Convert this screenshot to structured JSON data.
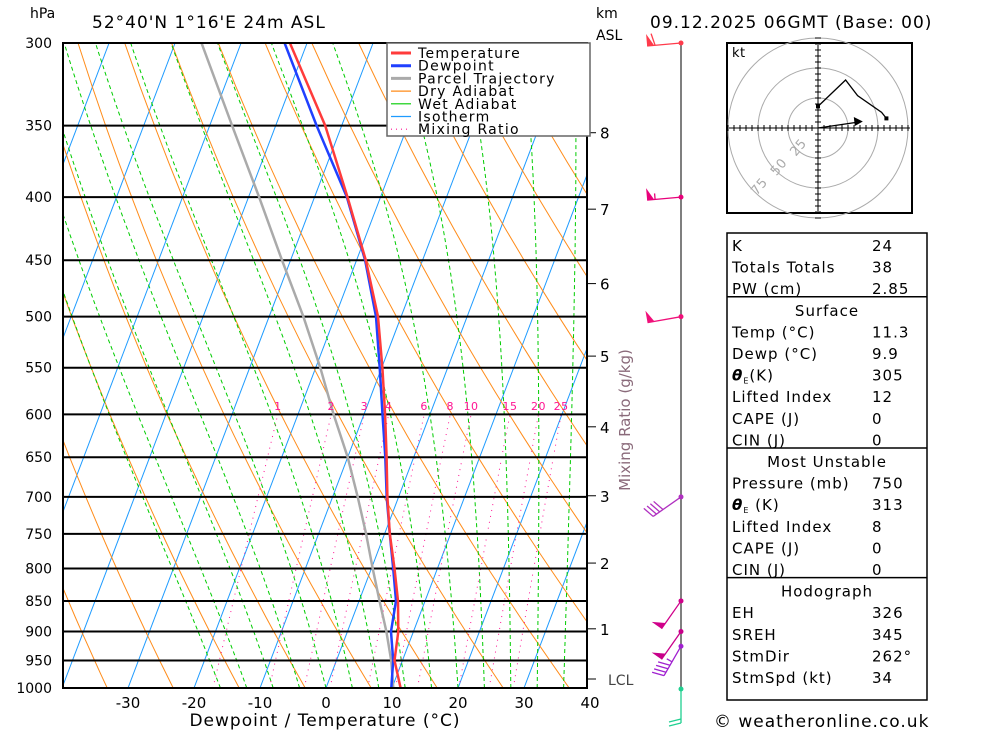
{
  "header": {
    "pressure_unit": "hPa",
    "location": "52°40'N 1°16'E 24m ASL",
    "height_unit": "km",
    "height_ref": "ASL",
    "datetime": "09.12.2025 06GMT (Base: 00)"
  },
  "chart_data": {
    "type": "skew-t",
    "xlabel": "Dewpoint / Temperature (°C)",
    "x_ticks": [
      -30,
      -20,
      -10,
      0,
      10,
      20,
      30,
      40
    ],
    "xlim": [
      -40,
      40
    ],
    "pressure_ticks": [
      300,
      350,
      400,
      450,
      500,
      550,
      600,
      650,
      700,
      750,
      800,
      850,
      900,
      950,
      1000
    ],
    "ylim_hpa": [
      1000,
      300
    ],
    "km_ticks": [
      1,
      2,
      3,
      4,
      5,
      6,
      7,
      8
    ],
    "lcl_label": "LCL",
    "mixing_ratio_label": "Mixing Ratio (g/kg)",
    "mixing_ratio_values": [
      1,
      2,
      3,
      4,
      6,
      8,
      10,
      15,
      20,
      25
    ],
    "legend": [
      {
        "label": "Temperature",
        "color": "#ff3b3b",
        "style": "thick"
      },
      {
        "label": "Dewpoint",
        "color": "#2040ff",
        "style": "thick"
      },
      {
        "label": "Parcel Trajectory",
        "color": "#aaaaaa",
        "style": "thick"
      },
      {
        "label": "Dry Adiabat",
        "color": "#ff8c1a",
        "style": "thin"
      },
      {
        "label": "Wet Adiabat",
        "color": "#00cc00",
        "style": "thin"
      },
      {
        "label": "Isotherm",
        "color": "#1e9bff",
        "style": "thin"
      },
      {
        "label": "Mixing Ratio",
        "color": "#ff1493",
        "style": "dotted"
      }
    ],
    "series": [
      {
        "name": "Temperature",
        "color": "#ff3b3b",
        "points": [
          [
            1000,
            11.3
          ],
          [
            950,
            8.8
          ],
          [
            900,
            7.7
          ],
          [
            850,
            5.9
          ],
          [
            800,
            3.5
          ],
          [
            750,
            0.8
          ],
          [
            700,
            -1.7
          ],
          [
            650,
            -4.1
          ],
          [
            600,
            -6.8
          ],
          [
            550,
            -9.9
          ],
          [
            500,
            -13.5
          ],
          [
            450,
            -18.6
          ],
          [
            400,
            -25.0
          ],
          [
            350,
            -32.5
          ],
          [
            300,
            -42.6
          ]
        ]
      },
      {
        "name": "Dewpoint",
        "color": "#2040ff",
        "points": [
          [
            1000,
            9.9
          ],
          [
            950,
            8.6
          ],
          [
            900,
            6.6
          ],
          [
            850,
            5.6
          ],
          [
            800,
            3.3
          ],
          [
            750,
            0.8
          ],
          [
            700,
            -1.8
          ],
          [
            650,
            -4.3
          ],
          [
            600,
            -7.2
          ],
          [
            550,
            -10.3
          ],
          [
            500,
            -13.8
          ],
          [
            450,
            -18.7
          ],
          [
            400,
            -25.1
          ],
          [
            350,
            -33.8
          ],
          [
            300,
            -43.4
          ]
        ]
      },
      {
        "name": "Parcel Trajectory",
        "color": "#aaaaaa",
        "points": [
          [
            1000,
            10.2
          ],
          [
            950,
            8.3
          ],
          [
            900,
            5.9
          ],
          [
            850,
            3.1
          ],
          [
            800,
            0.2
          ],
          [
            750,
            -2.8
          ],
          [
            700,
            -6.2
          ],
          [
            650,
            -10.0
          ],
          [
            600,
            -14.6
          ],
          [
            550,
            -19.3
          ],
          [
            500,
            -24.8
          ],
          [
            450,
            -31.3
          ],
          [
            400,
            -38.4
          ],
          [
            350,
            -46.6
          ],
          [
            300,
            -56.0
          ]
        ]
      }
    ],
    "wind_barbs": [
      {
        "pressure": 300,
        "direction": 265,
        "speed_kt": 60,
        "color": "#ff3b4b"
      },
      {
        "pressure": 400,
        "direction": 265,
        "speed_kt": 55,
        "color": "#e8007a"
      },
      {
        "pressure": 500,
        "direction": 260,
        "speed_kt": 50,
        "color": "#f0107a"
      },
      {
        "pressure": 700,
        "direction": 235,
        "speed_kt": 40,
        "color": "#b030c0"
      },
      {
        "pressure": 850,
        "direction": 215,
        "speed_kt": 50,
        "color": "#d0008a"
      },
      {
        "pressure": 900,
        "direction": 215,
        "speed_kt": 50,
        "color": "#c8008a"
      },
      {
        "pressure": 925,
        "direction": 210,
        "speed_kt": 45,
        "color": "#a020d0"
      },
      {
        "pressure": 1000,
        "direction": 180,
        "speed_kt": 20,
        "color": "#20d090"
      }
    ],
    "hodograph": {
      "unit_label": "kt",
      "ring_labels": [
        25,
        50,
        75
      ],
      "points_uv_kt": [
        [
          0,
          18
        ],
        [
          23,
          40
        ],
        [
          33,
          27
        ],
        [
          53,
          13
        ],
        [
          57,
          8
        ]
      ],
      "storm_motion_uv_kt": [
        34,
        5
      ]
    }
  },
  "table": {
    "rows": [
      {
        "type": "row",
        "label": "K",
        "value": "24"
      },
      {
        "type": "row",
        "label": "Totals Totals",
        "value": "38"
      },
      {
        "type": "row",
        "label": "PW (cm)",
        "value": "2.85"
      },
      {
        "type": "header",
        "label": "Surface"
      },
      {
        "type": "row",
        "label": "Temp (°C)",
        "value": "11.3"
      },
      {
        "type": "row",
        "label": "Dewp (°C)",
        "value": "9.9"
      },
      {
        "type": "theta",
        "label": "θ",
        "sub": "E",
        "rest": "(K)",
        "value": "305"
      },
      {
        "type": "row",
        "label": "Lifted Index",
        "value": "12"
      },
      {
        "type": "row",
        "label": "CAPE (J)",
        "value": "0"
      },
      {
        "type": "row",
        "label": "CIN (J)",
        "value": "0"
      },
      {
        "type": "header",
        "label": "Most Unstable"
      },
      {
        "type": "row",
        "label": "Pressure (mb)",
        "value": "750"
      },
      {
        "type": "theta",
        "label": "θ",
        "sub": "E",
        "rest": " (K)",
        "value": "313"
      },
      {
        "type": "row",
        "label": "Lifted Index",
        "value": "8"
      },
      {
        "type": "row",
        "label": "CAPE (J)",
        "value": "0"
      },
      {
        "type": "row",
        "label": "CIN (J)",
        "value": "0"
      },
      {
        "type": "header",
        "label": "Hodograph"
      },
      {
        "type": "row",
        "label": "EH",
        "value": "326"
      },
      {
        "type": "row",
        "label": "SREH",
        "value": "345"
      },
      {
        "type": "row",
        "label": "StmDir",
        "value": "262°"
      },
      {
        "type": "row",
        "label": "StmSpd (kt)",
        "value": "34"
      }
    ]
  },
  "footer": {
    "copyright": "© weatheronline.co.uk"
  }
}
